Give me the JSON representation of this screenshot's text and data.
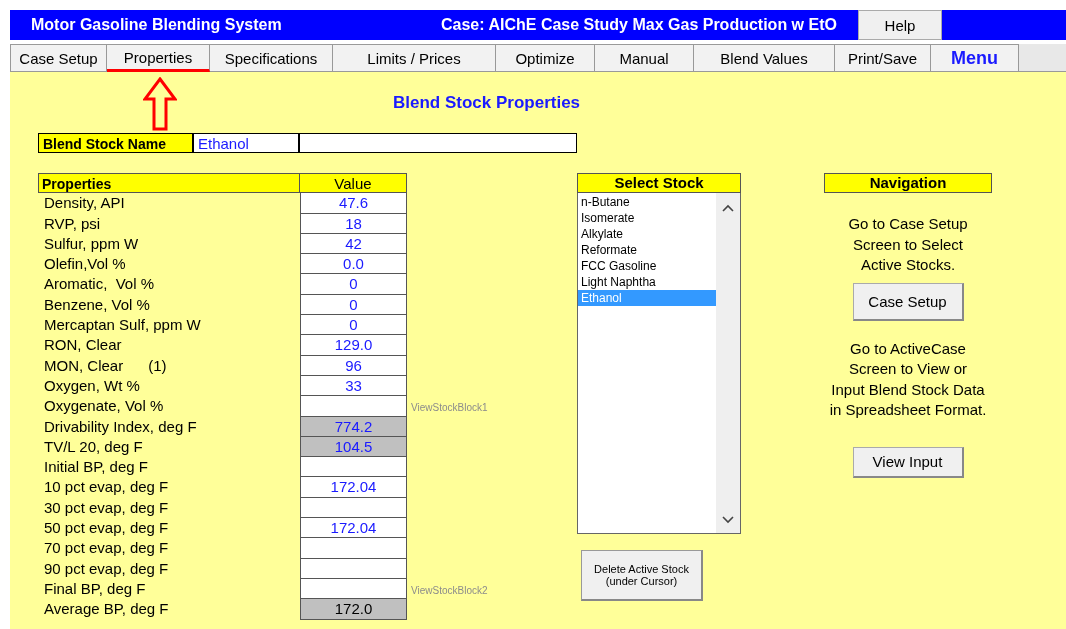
{
  "title_bar": {
    "app_title": "Motor Gasoline Blending System",
    "case_title": "Case:  AIChE Case Study Max Gas Production w EtO",
    "help_button": "Help"
  },
  "tabs": [
    {
      "label": "Case Setup",
      "selected": false,
      "kind": "tab"
    },
    {
      "label": "Properties",
      "selected": true,
      "kind": "tab"
    },
    {
      "label": "Specifications",
      "selected": false,
      "kind": "tab"
    },
    {
      "label": "Limits / Prices",
      "selected": false,
      "kind": "tab"
    },
    {
      "label": "Optimize",
      "selected": false,
      "kind": "tab"
    },
    {
      "label": "Manual",
      "selected": false,
      "kind": "tab"
    },
    {
      "label": "Blend Values",
      "selected": false,
      "kind": "tab"
    },
    {
      "label": "Print/Save",
      "selected": false,
      "kind": "tab"
    },
    {
      "label": "Menu",
      "selected": false,
      "kind": "menu"
    }
  ],
  "heading": "Blend Stock Properties",
  "blend_stock_name": {
    "label": "Blend Stock Name",
    "value": "Ethanol"
  },
  "properties_table": {
    "columns": [
      "Properties",
      "Value"
    ],
    "rows": [
      {
        "name": "Density, API",
        "value": "47.6",
        "computed": false
      },
      {
        "name": "RVP, psi",
        "value": "18",
        "computed": false
      },
      {
        "name": "Sulfur, ppm W",
        "value": "42",
        "computed": false
      },
      {
        "name": "Olefin,Vol %",
        "value": "0.0",
        "computed": false
      },
      {
        "name": "Aromatic,  Vol %",
        "value": "0",
        "computed": false
      },
      {
        "name": "Benzene, Vol %",
        "value": "0",
        "computed": false
      },
      {
        "name": "Mercaptan Sulf, ppm W",
        "value": "0",
        "computed": false
      },
      {
        "name": "RON, Clear",
        "value": "129.0",
        "computed": false
      },
      {
        "name": "MON, Clear      (1)",
        "value": "96",
        "computed": false
      },
      {
        "name": "Oxygen, Wt %",
        "value": "33",
        "computed": false
      },
      {
        "name": "Oxygenate, Vol %",
        "value": "",
        "computed": false,
        "note": "ViewStockBlock1"
      },
      {
        "name": "Drivability Index, deg F",
        "value": "774.2",
        "computed": true
      },
      {
        "name": "TV/L 20, deg F",
        "value": "104.5",
        "computed": true
      },
      {
        "name": "Initial BP, deg F",
        "value": "",
        "computed": false
      },
      {
        "name": "10 pct evap, deg F",
        "value": "172.04",
        "computed": false
      },
      {
        "name": "30 pct evap, deg F",
        "value": "",
        "computed": false
      },
      {
        "name": "50 pct evap, deg F",
        "value": "172.04",
        "computed": false
      },
      {
        "name": "70 pct evap, deg F",
        "value": "",
        "computed": false
      },
      {
        "name": "90 pct evap, deg F",
        "value": "",
        "computed": false
      },
      {
        "name": "Final BP, deg F",
        "value": "",
        "computed": false,
        "note": "ViewStockBlock2"
      },
      {
        "name": "Average BP, deg F",
        "value": "172.0",
        "computed": true,
        "total": true
      }
    ]
  },
  "select_stock": {
    "header": "Select Stock",
    "items": [
      {
        "label": "n-Butane",
        "selected": false
      },
      {
        "label": "Isomerate",
        "selected": false
      },
      {
        "label": "Alkylate",
        "selected": false
      },
      {
        "label": "Reformate",
        "selected": false
      },
      {
        "label": "FCC Gasoline",
        "selected": false
      },
      {
        "label": "Light Naphtha",
        "selected": false
      },
      {
        "label": "Ethanol",
        "selected": true
      }
    ],
    "delete_button": [
      "Delete Active  Stock",
      "(under Cursor)"
    ]
  },
  "navigation": {
    "header": "Navigation",
    "text_1": [
      "Go to Case Setup",
      "Screen to Select",
      "Active Stocks."
    ],
    "button_1": "Case Setup",
    "text_2": [
      "Go to ActiveCase",
      "Screen to View or",
      "Input Blend Stock Data",
      "in Spreadsheet Format."
    ],
    "button_2": "View Input"
  }
}
